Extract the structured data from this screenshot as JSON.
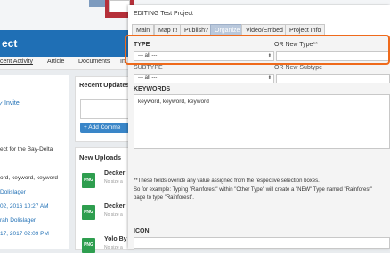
{
  "background_page": {
    "project_header": {
      "title_fragment": "ect"
    },
    "nav": {
      "items": [
        "cent Activity",
        "Article",
        "Documents",
        "In"
      ]
    },
    "left": {
      "invite_label": "Invite",
      "project_desc": "ect for the Bay-Delta",
      "keywords": "ord, keyword, keyword",
      "author1": "Dolislager",
      "date1": "02, 2016 10:27 AM",
      "author2": "rah Dolislager",
      "date2": "17, 2017 02:09 PM"
    },
    "middle": {
      "recent_updates_heading": "Recent Updates",
      "add_comment_label": "+ Add Comme",
      "new_uploads_heading": "New Uploads",
      "uploads": [
        {
          "icon": "PNG",
          "name": "Decker",
          "sub": "No size a"
        },
        {
          "icon": "PNG",
          "name": "Decker",
          "sub": "No size a"
        },
        {
          "icon": "PNG",
          "name": "Yolo By",
          "sub": "No size a"
        }
      ]
    }
  },
  "modal": {
    "title": "EDITING Test Project",
    "tabs": [
      "Main",
      "Map It!",
      "Publish?",
      "Organize",
      "Video/Embed",
      "Project Info"
    ],
    "active_tab": "Organize",
    "type_label": "TYPE",
    "type_value": "--- all ---",
    "new_type_label": "OR New Type**",
    "subtype_label": "SUBTYPE",
    "subtype_value": "--- all ---",
    "new_subtype_label": "OR New Subtype",
    "keywords_label": "KEYWORDS",
    "keywords_value": "keyword, keyword, keyword",
    "note_line1": "**These fields overide any value assigned from the respective selection boxes.",
    "note_line2": "So for example: Typing \"Rainforest\" within \"Other Type\" will create a \"NEW\" Type named \"Rainforest\"",
    "note_line3": "page to type \"Rainforest\".",
    "icon_label": "ICON",
    "colors": {
      "highlight": "#ef6a1b",
      "header_blue": "#1f6fb5",
      "active_tab": "#b9c8dc"
    }
  }
}
